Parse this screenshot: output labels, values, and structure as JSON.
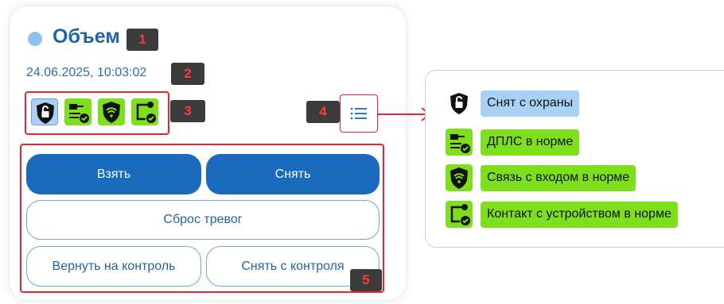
{
  "card": {
    "title": "Объем",
    "datetime": "24.06.2025, 10:03:02",
    "status_icons": [
      "guard-off-lock-icon",
      "line-ok-icon",
      "link-ok-shield-icon",
      "device-contact-ok-icon"
    ],
    "buttons": {
      "take": "Взять",
      "remove": "Снять",
      "reset_alarms": "Сброс тревог",
      "return_control": "Вернуть на контроль",
      "remove_control": "Снять с контроля"
    }
  },
  "annotations": [
    "1",
    "2",
    "3",
    "4",
    "5"
  ],
  "popup": {
    "items": [
      {
        "icon": "guard-off-lock-icon",
        "label": "Снят с охраны",
        "color": "#a9d0f5"
      },
      {
        "icon": "line-ok-icon",
        "label": "ДПЛС в норме",
        "color": "#7ee01c"
      },
      {
        "icon": "link-ok-shield-icon",
        "label": "Связь с входом в норме",
        "color": "#7ee01c"
      },
      {
        "icon": "device-contact-ok-icon",
        "label": "Контакт с устройством в норме",
        "color": "#7ee01c"
      }
    ]
  },
  "colors": {
    "accent": "#1a6bbd",
    "annotation_red": "#e8232b",
    "status_green": "#7ee01c",
    "status_blue": "#a9d0f5"
  }
}
